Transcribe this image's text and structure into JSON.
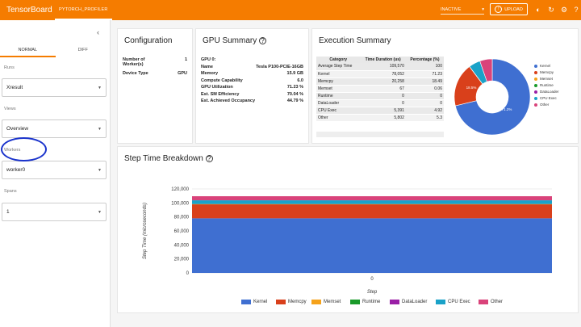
{
  "app": {
    "title": "TensorBoard",
    "plugin_tab": "PYTORCH_PROFILER",
    "status": "INACTIVE",
    "upload_label": "UPLOAD"
  },
  "sidebar": {
    "collapse_icon": "chevron-left-icon",
    "tabs": [
      "NORMAL",
      "DIFF"
    ],
    "runs_label": "Runs",
    "runs_value": "Xresult",
    "views_label": "Views",
    "views_value": "Overview",
    "workers_label": "Workers",
    "workers_value": "worker0",
    "spans_label": "Spans",
    "spans_value": "1"
  },
  "configuration": {
    "title": "Configuration",
    "rows": [
      {
        "k": "Number of Worker(s)",
        "v": "1"
      },
      {
        "k": "Device Type",
        "v": "GPU"
      }
    ]
  },
  "gpu_summary": {
    "title": "GPU Summary",
    "rows": [
      {
        "k": "GPU 0:",
        "v": ""
      },
      {
        "k": "Name",
        "v": "Tesla P100-PCIE-16GB"
      },
      {
        "k": "Memory",
        "v": "15.9 GB"
      },
      {
        "k": "Compute Capability",
        "v": "6.0"
      },
      {
        "k": "GPU Utilization",
        "v": "71.23 %"
      },
      {
        "k": "Est. SM Efficiency",
        "v": "70.04 %"
      },
      {
        "k": "Est. Achieved Occupancy",
        "v": "44.79 %"
      }
    ]
  },
  "execution_summary": {
    "title": "Execution Summary",
    "columns": [
      "Category",
      "Time Duration (us)",
      "Percentage (%)"
    ],
    "rows": [
      [
        "Average Step Time",
        "109,570",
        "100"
      ],
      [
        "Kernel",
        "78,052",
        "71.23"
      ],
      [
        "Memcpy",
        "20,258",
        "18.49"
      ],
      [
        "Memset",
        "67",
        "0.06"
      ],
      [
        "Runtime",
        "0",
        "0"
      ],
      [
        "DataLoader",
        "0",
        "0"
      ],
      [
        "CPU Exec",
        "5,391",
        "4.92"
      ],
      [
        "Other",
        "5,802",
        "5.3"
      ]
    ],
    "pie_labels": [
      "71.2%",
      "18.5%"
    ],
    "legend": [
      "Kernel",
      "Memcpy",
      "Memset",
      "Runtime",
      "DataLoader",
      "CPU Exec",
      "Other"
    ]
  },
  "colors": {
    "accent": "#f57c00",
    "Kernel": "#3f6fd1",
    "Memcpy": "#d9401b",
    "Memset": "#f5a21a",
    "Runtime": "#1a9a2a",
    "DataLoader": "#9a1fa6",
    "CPU Exec": "#1aa2c8",
    "Other": "#d9437a"
  },
  "step_time": {
    "title": "Step Time Breakdown",
    "ylabel": "Step Time (microseconds)",
    "xlabel": "Step",
    "y_ticks": [
      "120,000",
      "100,000",
      "80,000",
      "60,000",
      "40,000",
      "20,000",
      "0"
    ],
    "x_tick": "0",
    "legend": [
      "Kernel",
      "Memcpy",
      "Memset",
      "Runtime",
      "DataLoader",
      "CPU Exec",
      "Other"
    ]
  },
  "chart_data": [
    {
      "type": "pie",
      "labels": [
        "Kernel",
        "Memcpy",
        "Memset",
        "Runtime",
        "DataLoader",
        "CPU Exec",
        "Other"
      ],
      "values": [
        71.23,
        18.49,
        0.06,
        0,
        0,
        4.92,
        5.3
      ]
    },
    {
      "type": "bar",
      "title": "Step Time Breakdown",
      "xlabel": "Step",
      "ylabel": "Step Time (microseconds)",
      "categories": [
        "0"
      ],
      "ylim": [
        0,
        120000
      ],
      "series": [
        {
          "name": "Kernel",
          "values": [
            78052
          ]
        },
        {
          "name": "Memcpy",
          "values": [
            20258
          ]
        },
        {
          "name": "Memset",
          "values": [
            67
          ]
        },
        {
          "name": "Runtime",
          "values": [
            0
          ]
        },
        {
          "name": "DataLoader",
          "values": [
            0
          ]
        },
        {
          "name": "CPU Exec",
          "values": [
            5391
          ]
        },
        {
          "name": "Other",
          "values": [
            5802
          ]
        }
      ]
    }
  ]
}
